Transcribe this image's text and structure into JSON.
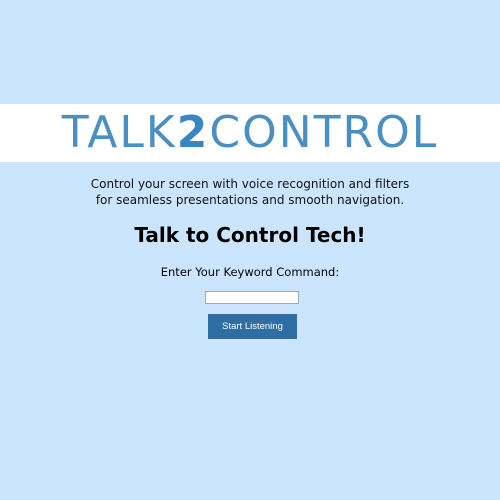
{
  "header": {
    "logo_prefix": "TALK",
    "logo_number": "2",
    "logo_suffix": "CONTROL"
  },
  "intro": {
    "line1": "Control your screen with voice recognition and filters",
    "line2": "for seamless presentations and smooth navigation."
  },
  "main": {
    "heading": "Talk to Control Tech!",
    "prompt_label": "Enter Your Keyword Command:",
    "keyword_value": "",
    "start_button_label": "Start Listening"
  },
  "colors": {
    "page_background": "#cce5ff",
    "banner_background": "#ffffff",
    "logo_color": "#4a8fc4",
    "button_background": "#2f6ea4",
    "button_text": "#ffffff"
  }
}
